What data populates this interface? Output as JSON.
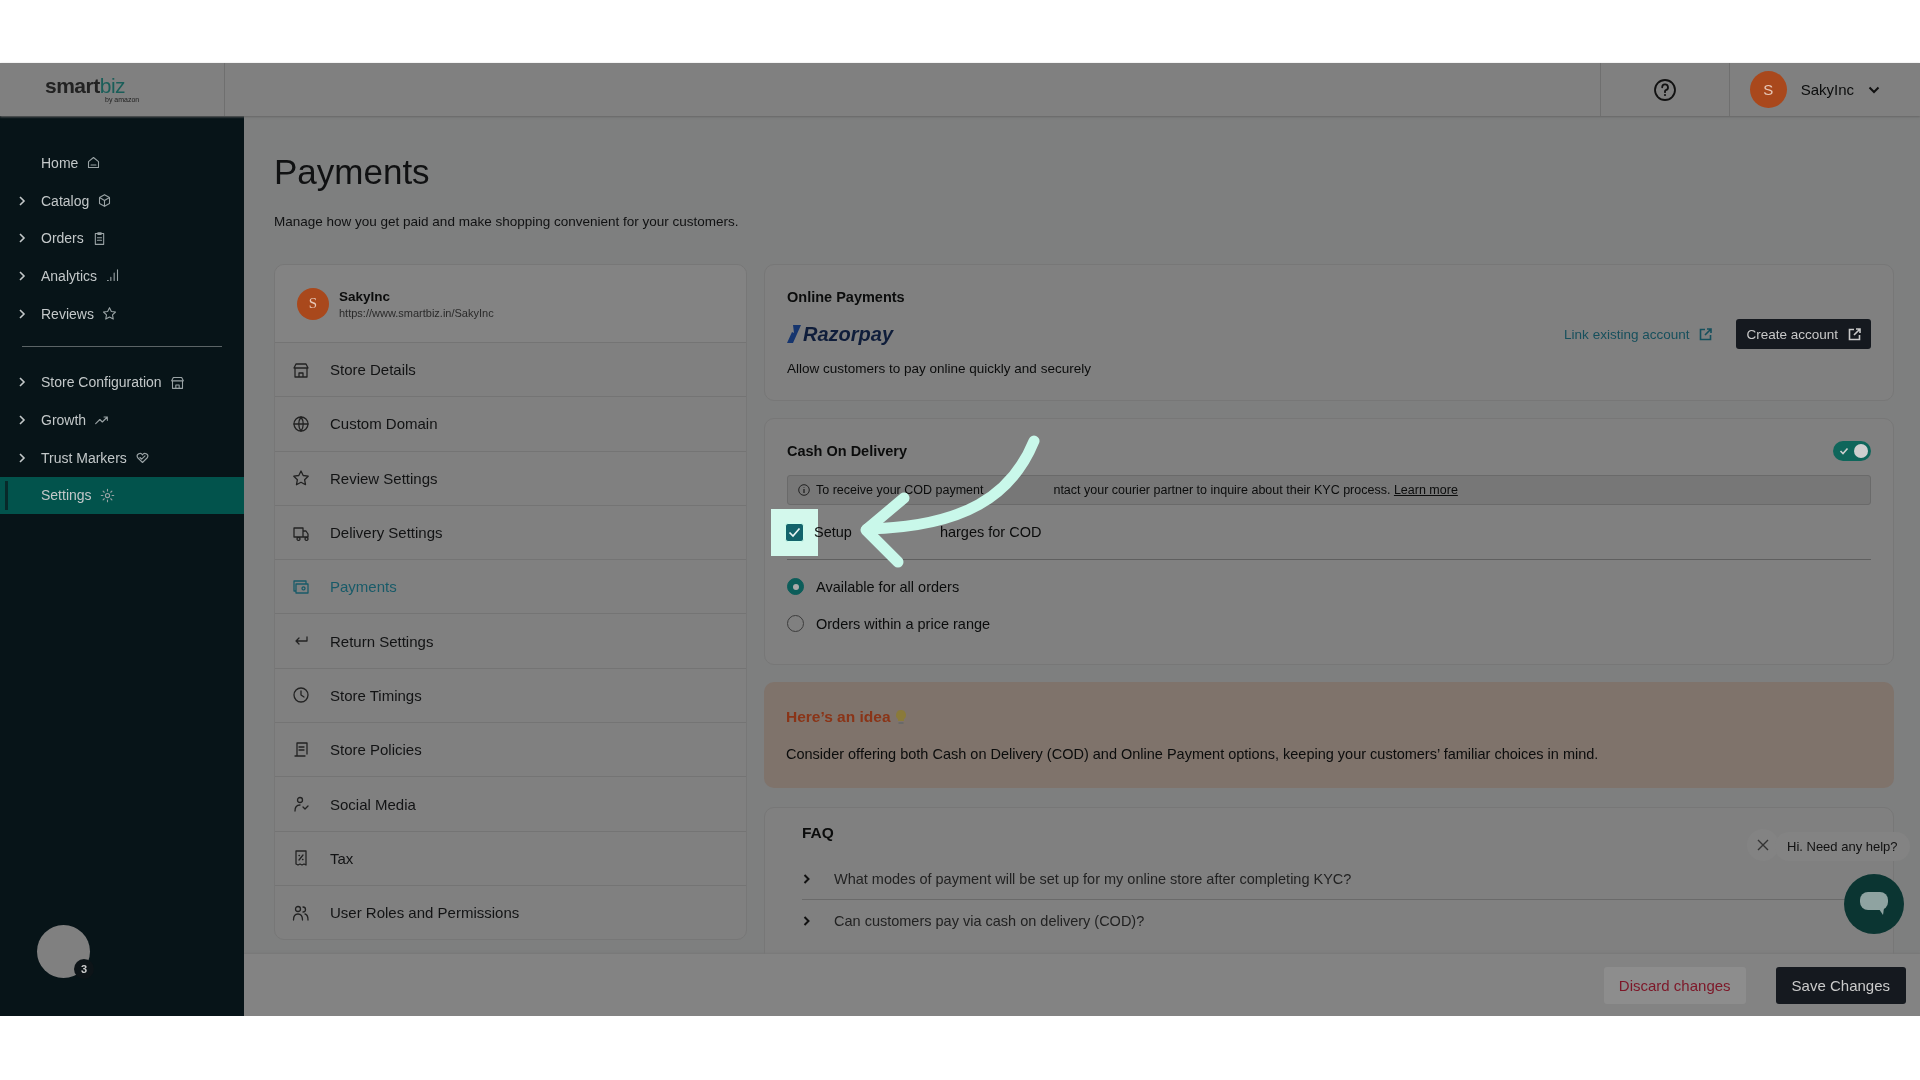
{
  "header": {
    "logo_main": "sm",
    "logo_main_2": "art",
    "logo_accent": "biz",
    "logo_sub": "by amazon",
    "user": {
      "initial": "S",
      "name": "SakyInc"
    }
  },
  "sidebar": {
    "sections": [
      {
        "items": [
          {
            "label": "Home",
            "expandable": false,
            "selected": false
          },
          {
            "label": "Catalog",
            "expandable": true,
            "selected": false
          },
          {
            "label": "Orders",
            "expandable": true,
            "selected": false
          },
          {
            "label": "Analytics",
            "expandable": true,
            "selected": false
          },
          {
            "label": "Reviews",
            "expandable": true,
            "selected": false
          }
        ]
      },
      {
        "items": [
          {
            "label": "Store Configuration",
            "expandable": true,
            "selected": false
          },
          {
            "label": "Growth",
            "expandable": true,
            "selected": false
          },
          {
            "label": "Trust Markers",
            "expandable": true,
            "selected": false
          },
          {
            "label": "Settings",
            "expandable": false,
            "selected": true
          }
        ]
      }
    ],
    "badge": "3"
  },
  "page": {
    "title": "Payments",
    "subtitle": "Manage how you get paid and make shopping convenient for your customers."
  },
  "settings_menu": {
    "store": {
      "initial": "S",
      "name": "SakyInc",
      "url": "https://www.smartbiz.in/SakyInc"
    },
    "items": [
      {
        "label": "Store Details",
        "selected": false
      },
      {
        "label": "Custom Domain",
        "selected": false
      },
      {
        "label": "Review Settings",
        "selected": false
      },
      {
        "label": "Delivery Settings",
        "selected": false
      },
      {
        "label": "Payments",
        "selected": true
      },
      {
        "label": "Return Settings",
        "selected": false
      },
      {
        "label": "Store Timings",
        "selected": false
      },
      {
        "label": "Store Policies",
        "selected": false
      },
      {
        "label": "Social Media",
        "selected": false
      },
      {
        "label": "Tax",
        "selected": false
      },
      {
        "label": "User Roles and Permissions",
        "selected": false
      }
    ]
  },
  "online_payments": {
    "title": "Online Payments",
    "provider": "Razorpay",
    "description": "Allow customers to pay online quickly and securely",
    "link": "Link existing account",
    "button": "Create account"
  },
  "cod": {
    "title": "Cash On Delivery",
    "on": true,
    "notice": [
      "To receive your COD payment",
      "ntact your courier partner to inquire about their KYC process."
    ],
    "notice_link": "Learn more",
    "checkbox": {
      "checked": true,
      "label": [
        "Setup",
        "harges for COD"
      ]
    },
    "options": [
      {
        "label": "Available for all orders",
        "selected": true
      },
      {
        "label": "Orders within a price range",
        "selected": false
      }
    ]
  },
  "idea": {
    "title": "Here’s an idea",
    "text": "Consider offering both Cash on Delivery (COD) and Online Payment options, keeping your customers’ familiar choices in mind."
  },
  "faq": {
    "title": "FAQ",
    "items": [
      {
        "question": "What modes of payment will be set up for my online store after completing KYC?",
        "expanded": false
      },
      {
        "question": "Can customers pay via cash on delivery (COD)?",
        "expanded": false
      }
    ]
  },
  "chat": {
    "greeting": "Hi. Need any help?"
  },
  "footer": {
    "discard": "Discard changes",
    "save": "Save Changes"
  }
}
